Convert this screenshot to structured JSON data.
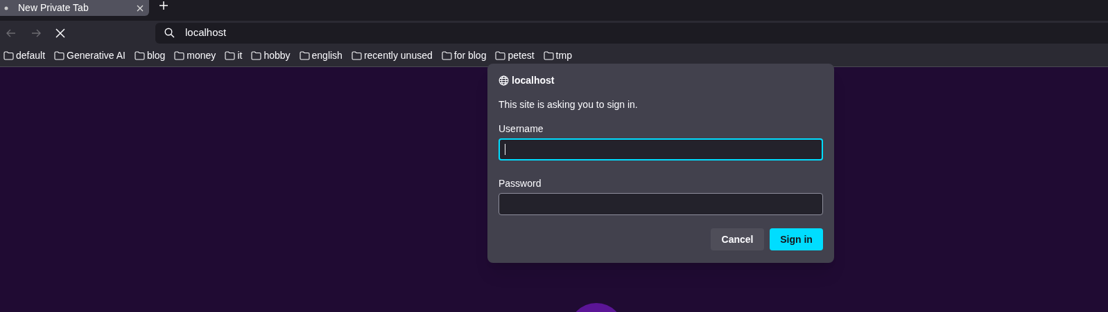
{
  "tabs": [
    {
      "title": "New Private Tab",
      "selected": true
    }
  ],
  "toolbar": {
    "back_disabled": true,
    "forward_disabled": true,
    "address": "localhost"
  },
  "bookmarks": [
    {
      "label": "default"
    },
    {
      "label": "Generative AI"
    },
    {
      "label": "blog"
    },
    {
      "label": "money"
    },
    {
      "label": "it"
    },
    {
      "label": "hobby"
    },
    {
      "label": "english"
    },
    {
      "label": "recently unused"
    },
    {
      "label": "for blog"
    },
    {
      "label": "petest"
    },
    {
      "label": "tmp"
    }
  ],
  "dialog": {
    "site": "localhost",
    "message": "This site is asking you to sign in.",
    "fields": [
      {
        "label": "Username",
        "focused": true
      },
      {
        "label": "Password",
        "focused": false
      }
    ],
    "buttons": [
      {
        "label": "Cancel",
        "kind": "secondary"
      },
      {
        "label": "Sign in",
        "kind": "primary"
      }
    ]
  }
}
